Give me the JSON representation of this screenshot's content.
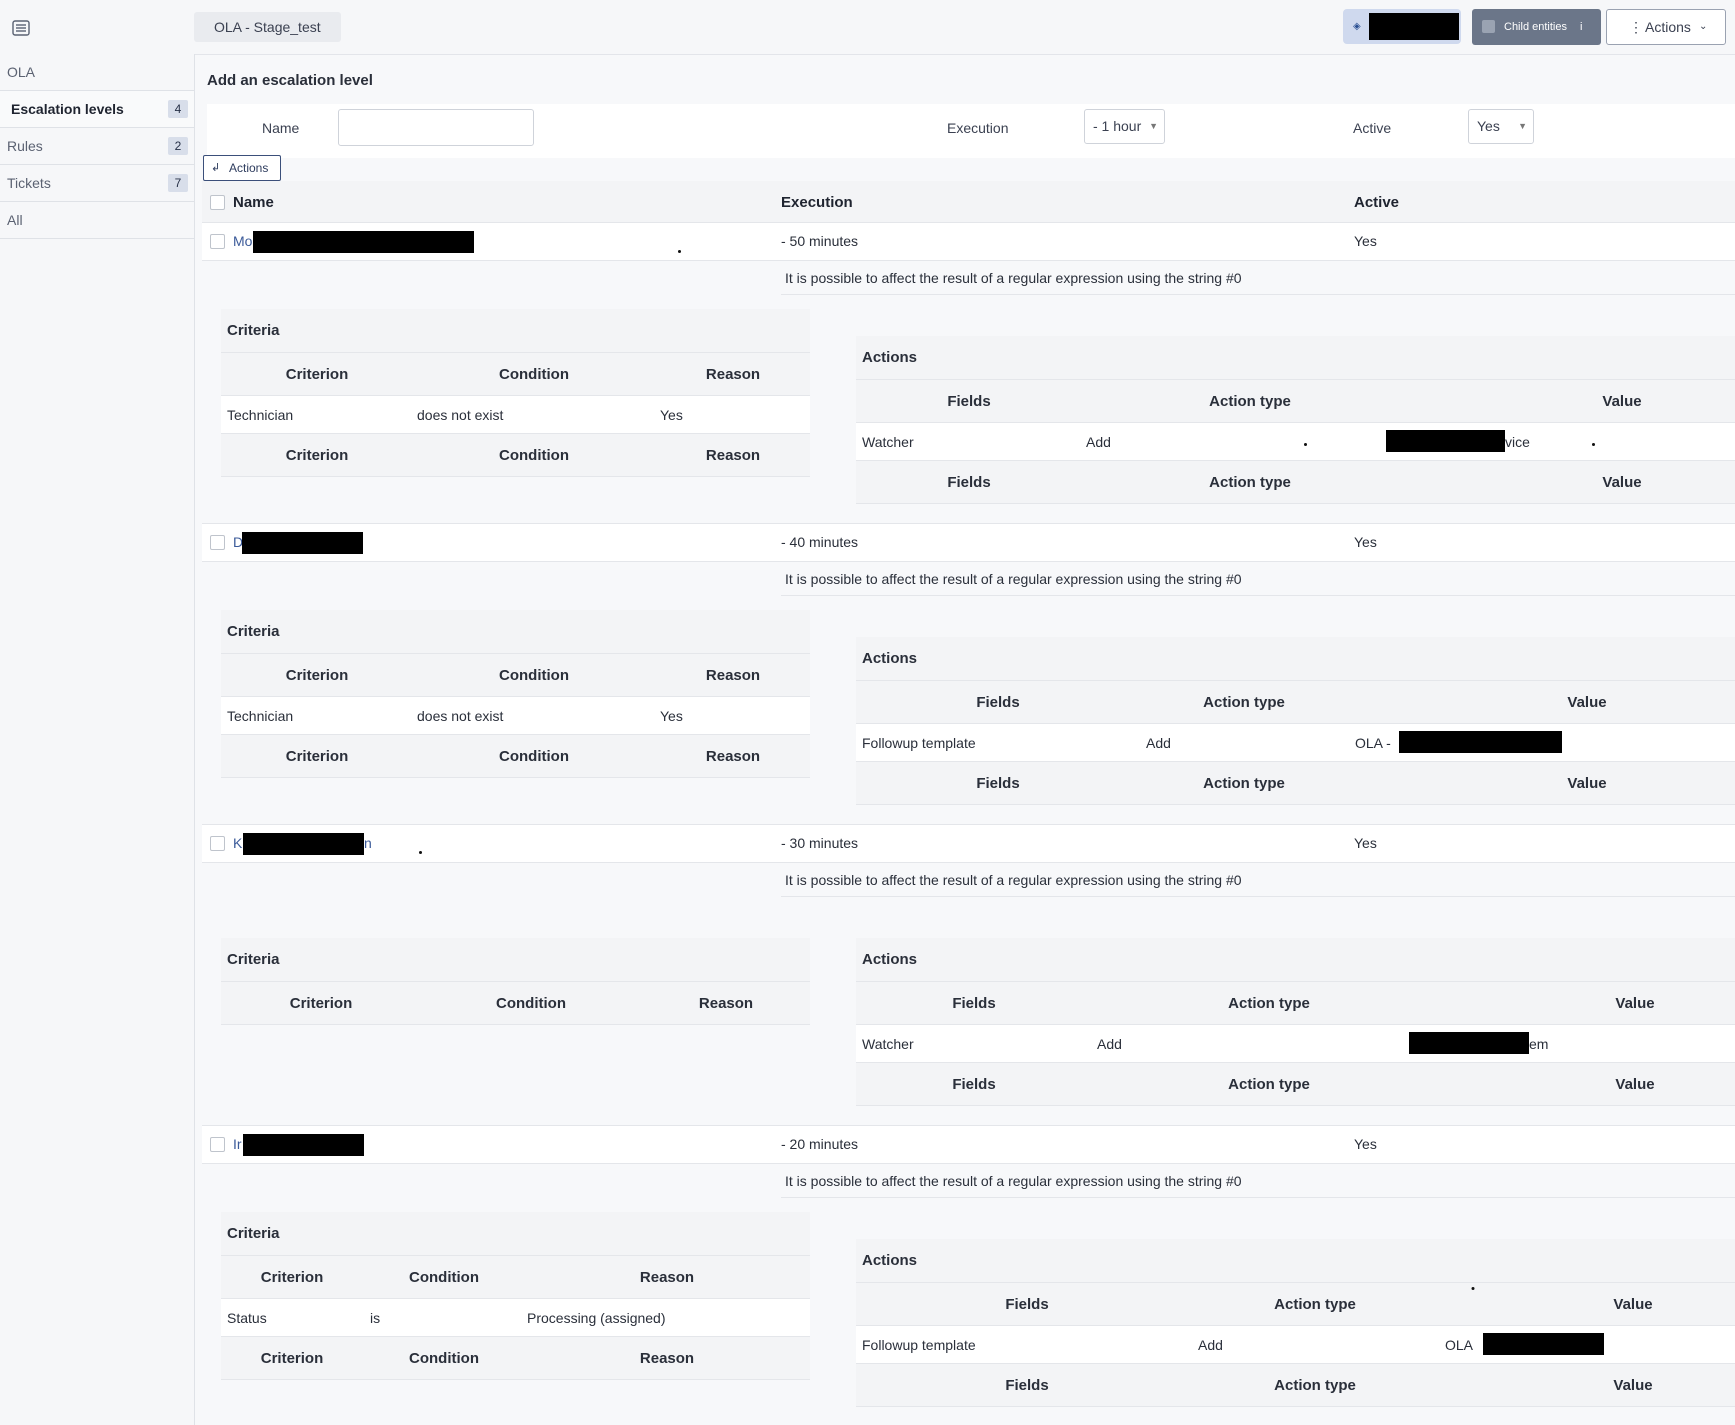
{
  "header": {
    "breadcrumb": "OLA - Stage_test",
    "child_entities_label": "Child entities",
    "child_entities_info": "i",
    "actions_label": "Actions"
  },
  "sidebar": {
    "items": [
      {
        "label": "OLA",
        "count": null,
        "active": false
      },
      {
        "label": "Escalation levels",
        "count": "4",
        "active": true
      },
      {
        "label": "Rules",
        "count": "2",
        "active": false
      },
      {
        "label": "Tickets",
        "count": "7",
        "active": false
      },
      {
        "label": "All",
        "count": null,
        "active": false
      }
    ]
  },
  "form": {
    "title": "Add an escalation level",
    "name_label": "Name",
    "name_value": "",
    "execution_label": "Execution",
    "execution_value": "- 1 hour",
    "active_label": "Active",
    "active_value": "Yes"
  },
  "massive_actions_label": "Actions",
  "table": {
    "col_name": "Name",
    "col_execution": "Execution",
    "col_active": "Active"
  },
  "labels": {
    "criteria": "Criteria",
    "criterion": "Criterion",
    "condition": "Condition",
    "reason": "Reason",
    "actions": "Actions",
    "fields": "Fields",
    "action_type": "Action type",
    "value": "Value"
  },
  "levels": [
    {
      "name": "Mo",
      "execution": "- 50 minutes",
      "active": "Yes",
      "note": "It is possible to affect the result of a regular expression using the string #0",
      "criteria": [
        {
          "criterion": "Technician",
          "condition": "does not exist",
          "reason": "Yes"
        }
      ],
      "actions": [
        {
          "field": "Watcher",
          "type": "Add",
          "value": "vice"
        }
      ]
    },
    {
      "name": "D",
      "execution": "- 40 minutes",
      "active": "Yes",
      "note": "It is possible to affect the result of a regular expression using the string #0",
      "criteria": [
        {
          "criterion": "Technician",
          "condition": "does not exist",
          "reason": "Yes"
        }
      ],
      "actions": [
        {
          "field": "Followup template",
          "type": "Add",
          "value": "OLA - "
        }
      ]
    },
    {
      "name": "K",
      "name_tail": "n",
      "execution": "- 30 minutes",
      "active": "Yes",
      "note": "It is possible to affect the result of a regular expression using the string #0",
      "criteria": [],
      "actions": [
        {
          "field": "Watcher",
          "type": "Add",
          "value": "em"
        }
      ]
    },
    {
      "name": "Ir",
      "execution": "- 20 minutes",
      "active": "Yes",
      "note": "It is possible to affect the result of a regular expression using the string #0",
      "criteria": [
        {
          "criterion": "Status",
          "condition": "is",
          "reason": "Processing (assigned)"
        }
      ],
      "actions": [
        {
          "field": "Followup template",
          "type": "Add",
          "value": "OLA"
        }
      ]
    }
  ]
}
